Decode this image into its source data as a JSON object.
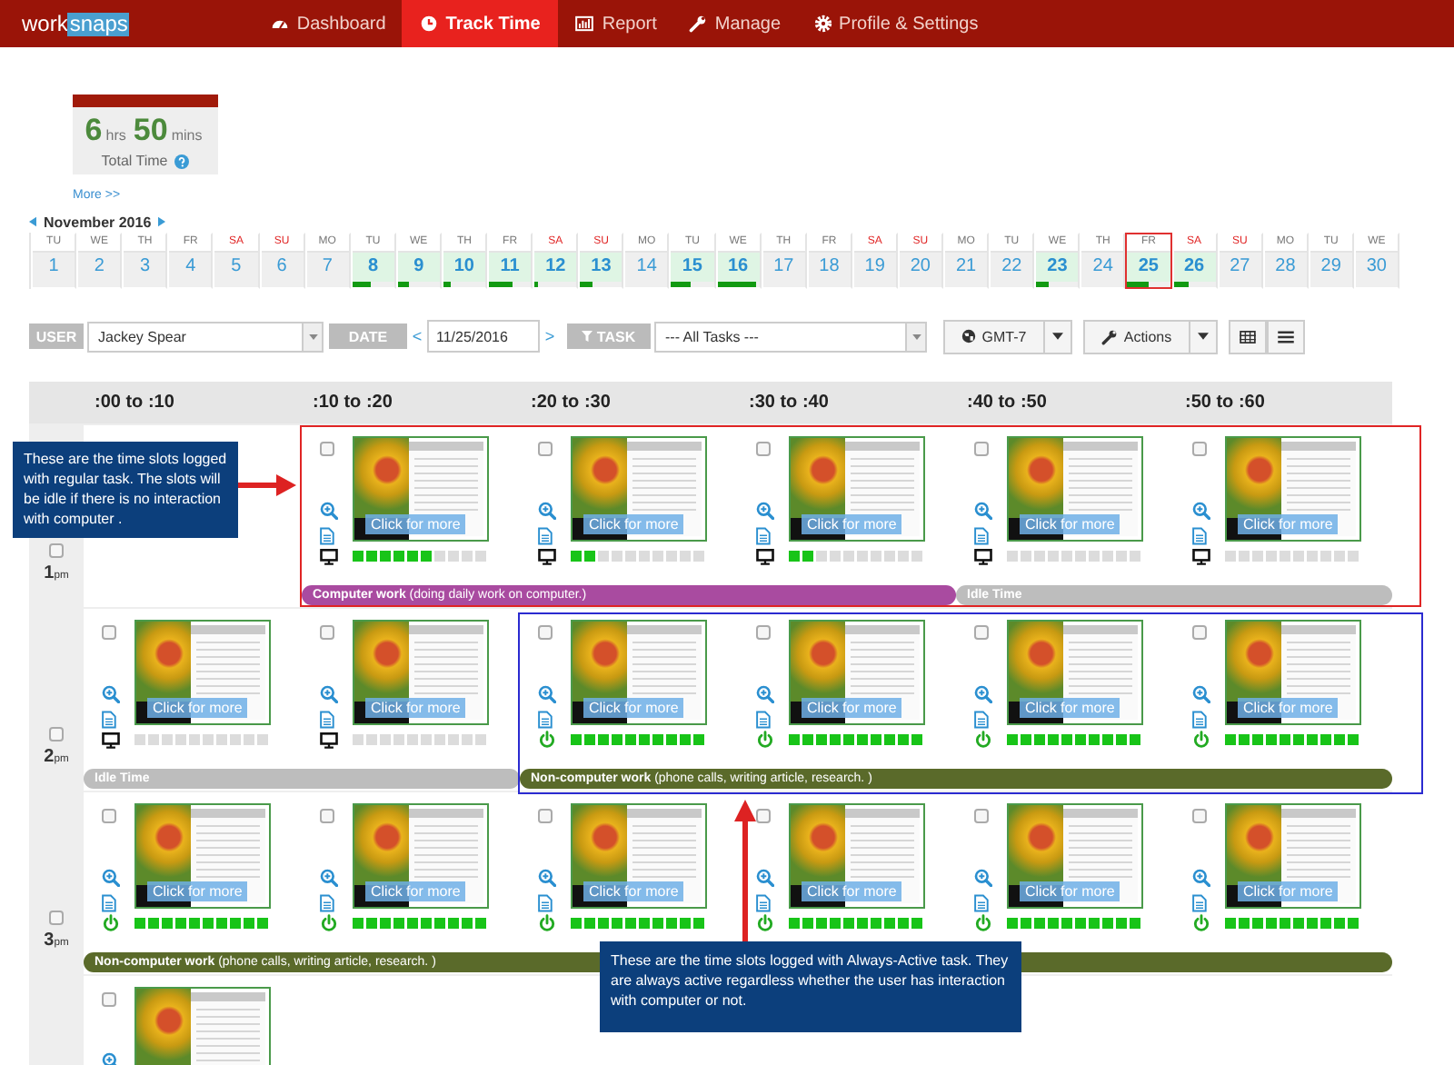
{
  "nav": {
    "logo": {
      "part_1": "work",
      "part_2": "snaps"
    },
    "items": [
      {
        "label": "Dashboard",
        "selected": false
      },
      {
        "label": "Track Time",
        "selected": true
      },
      {
        "label": "Report",
        "selected": false
      },
      {
        "label": "Manage",
        "selected": false
      },
      {
        "label": "Profile & Settings",
        "selected": false
      }
    ]
  },
  "summary": {
    "hours": "6",
    "hours_unit": "hrs",
    "minutes": "50",
    "minutes_unit": "mins",
    "label": "Total Time",
    "more_link": "More >>"
  },
  "calendar": {
    "month": "November 2016",
    "days": [
      {
        "weekday": "TU",
        "day": "1",
        "weekend": false,
        "active": false,
        "selected": false
      },
      {
        "weekday": "WE",
        "day": "2",
        "weekend": false,
        "active": false,
        "selected": false
      },
      {
        "weekday": "TH",
        "day": "3",
        "weekend": false,
        "active": false,
        "selected": false
      },
      {
        "weekday": "FR",
        "day": "4",
        "weekend": false,
        "active": false,
        "selected": false
      },
      {
        "weekday": "SA",
        "day": "5",
        "weekend": true,
        "active": false,
        "selected": false
      },
      {
        "weekday": "SU",
        "day": "6",
        "weekend": true,
        "active": false,
        "selected": false
      },
      {
        "weekday": "MO",
        "day": "7",
        "weekend": false,
        "active": false,
        "selected": false
      },
      {
        "weekday": "TU",
        "day": "8",
        "weekend": false,
        "active": true,
        "selected": false,
        "level": 0.45
      },
      {
        "weekday": "WE",
        "day": "9",
        "weekend": false,
        "active": true,
        "selected": false,
        "level": 0.25
      },
      {
        "weekday": "TH",
        "day": "10",
        "weekend": false,
        "active": true,
        "selected": false,
        "level": 0.18
      },
      {
        "weekday": "FR",
        "day": "11",
        "weekend": false,
        "active": true,
        "selected": false,
        "level": 0.55
      },
      {
        "weekday": "SA",
        "day": "12",
        "weekend": true,
        "active": true,
        "selected": false,
        "level": 0.1
      },
      {
        "weekday": "SU",
        "day": "13",
        "weekend": true,
        "active": true,
        "selected": false,
        "level": 0.3
      },
      {
        "weekday": "MO",
        "day": "14",
        "weekend": false,
        "active": false,
        "selected": false
      },
      {
        "weekday": "TU",
        "day": "15",
        "weekend": false,
        "active": true,
        "selected": false,
        "level": 0.45
      },
      {
        "weekday": "WE",
        "day": "16",
        "weekend": false,
        "active": true,
        "selected": false,
        "level": 0.95
      },
      {
        "weekday": "TH",
        "day": "17",
        "weekend": false,
        "active": false,
        "selected": false
      },
      {
        "weekday": "FR",
        "day": "18",
        "weekend": false,
        "active": false,
        "selected": false
      },
      {
        "weekday": "SA",
        "day": "19",
        "weekend": true,
        "active": false,
        "selected": false
      },
      {
        "weekday": "SU",
        "day": "20",
        "weekend": true,
        "active": false,
        "selected": false
      },
      {
        "weekday": "MO",
        "day": "21",
        "weekend": false,
        "active": false,
        "selected": false
      },
      {
        "weekday": "TU",
        "day": "22",
        "weekend": false,
        "active": false,
        "selected": false
      },
      {
        "weekday": "WE",
        "day": "23",
        "weekend": false,
        "active": true,
        "selected": false,
        "level": 0.3
      },
      {
        "weekday": "TH",
        "day": "24",
        "weekend": false,
        "active": false,
        "selected": false
      },
      {
        "weekday": "FR",
        "day": "25",
        "weekend": false,
        "active": true,
        "selected": true,
        "level": 0.5
      },
      {
        "weekday": "SA",
        "day": "26",
        "weekend": true,
        "active": true,
        "selected": false,
        "level": 0.35
      },
      {
        "weekday": "SU",
        "day": "27",
        "weekend": true,
        "active": false,
        "selected": false
      },
      {
        "weekday": "MO",
        "day": "28",
        "weekend": false,
        "active": false,
        "selected": false
      },
      {
        "weekday": "TU",
        "day": "29",
        "weekend": false,
        "active": false,
        "selected": false
      },
      {
        "weekday": "WE",
        "day": "30",
        "weekend": false,
        "active": false,
        "selected": false
      }
    ]
  },
  "toolbar": {
    "user_label": "USER",
    "user_value": "Jackey Spear",
    "date_label": "DATE",
    "prev": "<",
    "date": "11/25/2016",
    "next": ">",
    "task_label": "TASK",
    "task_value": "--- All Tasks ---",
    "timezone": "GMT-7",
    "actions": "Actions"
  },
  "grid": {
    "columns": [
      ":00 to :10",
      ":10 to :20",
      ":20 to :30",
      ":30 to :40",
      ":40 to :50",
      ":50 to :60"
    ],
    "rows": [
      {
        "hour": "1",
        "period": "pm",
        "checked": false,
        "groups": [
          {
            "slots": [
              {
                "kind": "empty"
              }
            ]
          },
          {
            "task": {
              "kind": "computer",
              "label": "**Computer work** (doing daily work on computer.)"
            },
            "slots": [
              {
                "kind": "computer",
                "checked": false,
                "caption": "Click for more",
                "level": 0.6
              },
              {
                "kind": "computer",
                "checked": false,
                "caption": "Click for more",
                "level": 0.2
              },
              {
                "kind": "computer",
                "checked": false,
                "caption": "Click for more",
                "level": 0.2
              }
            ]
          },
          {
            "task": {
              "kind": "idle",
              "label": "Idle Time"
            },
            "slots": [
              {
                "kind": "computer",
                "checked": false,
                "caption": "Click for more",
                "level": 0
              },
              {
                "kind": "computer",
                "checked": false,
                "caption": "Click for more",
                "level": 0
              }
            ]
          }
        ]
      },
      {
        "hour": "2",
        "period": "pm",
        "checked": false,
        "groups": [
          {
            "task": {
              "kind": "idle",
              "label": "Idle Time"
            },
            "slots": [
              {
                "kind": "computer",
                "checked": false,
                "caption": "Click for more",
                "level": 0
              },
              {
                "kind": "computer",
                "checked": false,
                "caption": "Click for more",
                "level": 0
              }
            ]
          },
          {
            "task": {
              "kind": "non_computer",
              "label": "**Non-computer work** (phone calls, writing article, research. )"
            },
            "slots": [
              {
                "kind": "always_active",
                "checked": false,
                "caption": "Click for more",
                "level": 1
              },
              {
                "kind": "always_active",
                "checked": false,
                "caption": "Click for more",
                "level": 1
              },
              {
                "kind": "always_active",
                "checked": false,
                "caption": "Click for more",
                "level": 1
              },
              {
                "kind": "always_active",
                "checked": false,
                "caption": "Click for more",
                "level": 1
              }
            ]
          }
        ]
      },
      {
        "hour": "3",
        "period": "pm",
        "checked": false,
        "groups": [
          {
            "task": {
              "kind": "non_computer",
              "label": "**Non-computer work** (phone calls, writing article, research. )"
            },
            "slots": [
              {
                "kind": "always_active",
                "checked": false,
                "caption": "Click for more",
                "level": 1
              },
              {
                "kind": "always_active",
                "checked": false,
                "caption": "Click for more",
                "level": 1
              },
              {
                "kind": "always_active",
                "checked": false,
                "caption": "Click for more",
                "level": 1
              },
              {
                "kind": "always_active",
                "checked": false,
                "caption": "Click for more",
                "level": 1
              },
              {
                "kind": "always_active",
                "checked": false,
                "caption": "Click for more",
                "level": 1
              },
              {
                "kind": "always_active",
                "checked": false,
                "caption": "Click for more",
                "level": 1
              }
            ]
          }
        ]
      },
      {
        "groups": [
          {
            "slots": [
              {
                "kind": "screenshot",
                "checked": false
              }
            ]
          }
        ]
      }
    ]
  },
  "annotations": [
    {
      "text": "These are the time slots logged with regular task. The slots will be idle if there is no interaction with computer .",
      "color": "#e02424"
    },
    {
      "text": "These are the time slots logged with Always-Active task. They are always active regardless whether the user has interaction with computer or not.",
      "color": "#2b2bd0"
    }
  ]
}
